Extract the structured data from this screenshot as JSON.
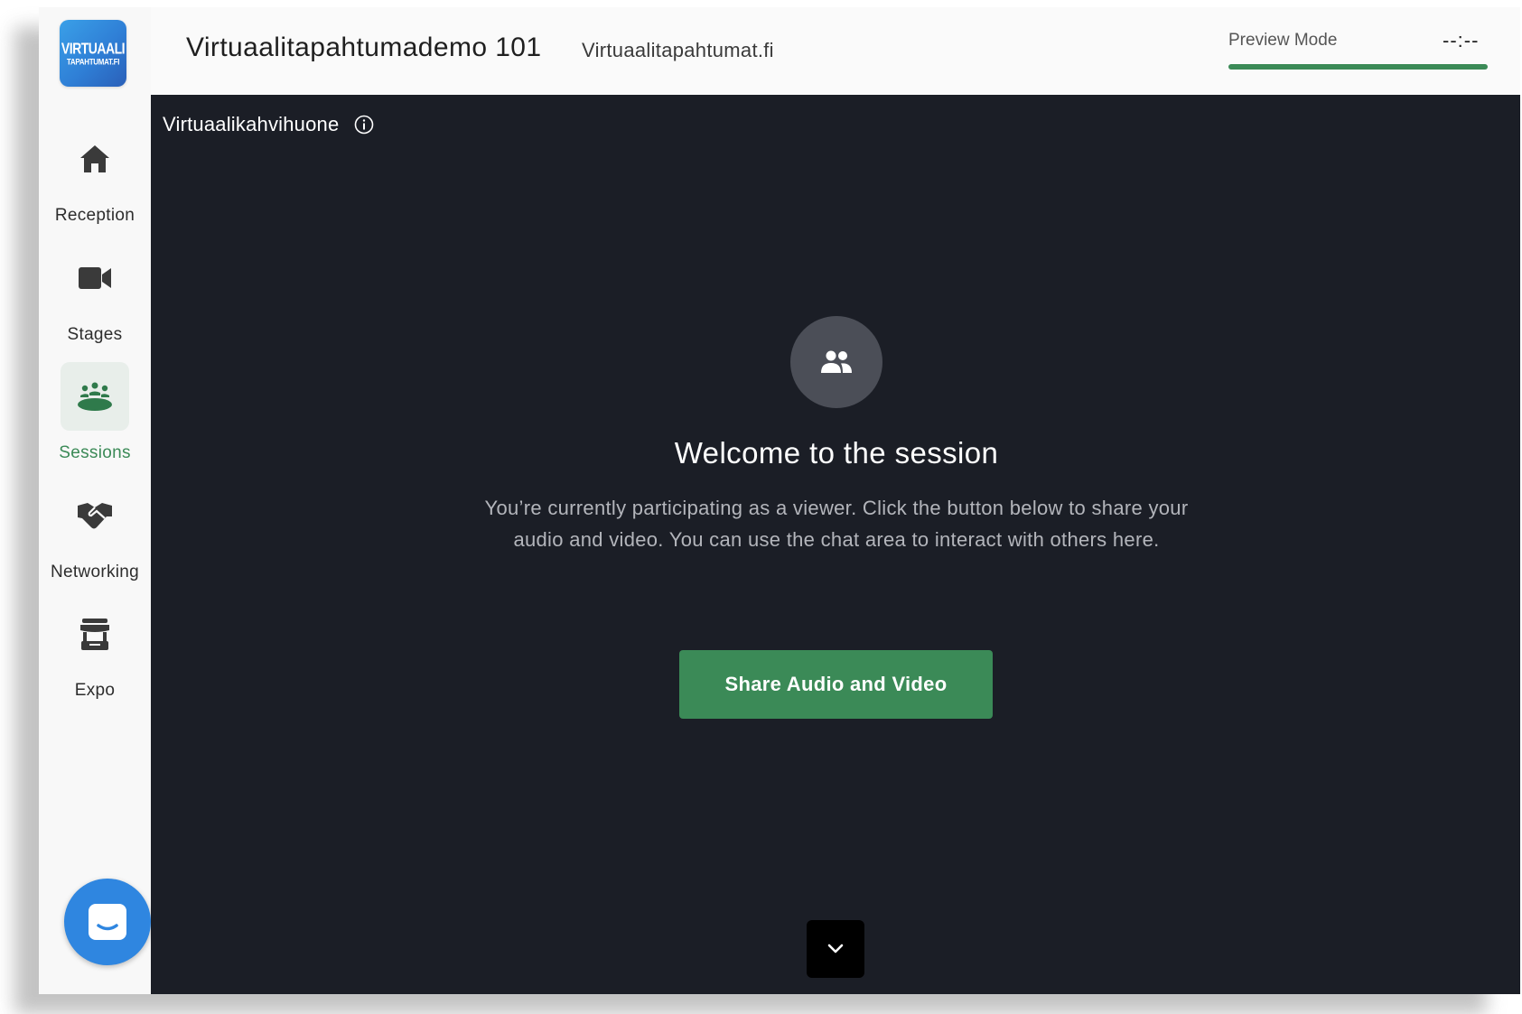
{
  "logo": {
    "line1": "VIRTUAALI",
    "line2": "TAPAHTUMAT.FI"
  },
  "sidebar": {
    "items": [
      {
        "label": "Reception",
        "icon": "home-icon",
        "active": false
      },
      {
        "label": "Stages",
        "icon": "video-camera-icon",
        "active": false
      },
      {
        "label": "Sessions",
        "icon": "group-table-icon",
        "active": true
      },
      {
        "label": "Networking",
        "icon": "handshake-icon",
        "active": false
      },
      {
        "label": "Expo",
        "icon": "booth-icon",
        "active": false
      }
    ]
  },
  "header": {
    "event_title": "Virtuaalitapahtumademo 101",
    "organizer": "Virtuaalitapahtumat.fi",
    "preview_mode": "Preview Mode",
    "timer": "--:--",
    "progress": 1.0
  },
  "main": {
    "room_name": "Virtuaalikahvihuone",
    "welcome_title": "Welcome to the session",
    "description": "You’re currently participating as a viewer. Click the button below to share your audio and video. You can use the chat area to interact with others here.",
    "share_button": "Share Audio and Video"
  },
  "colors": {
    "accent": "#3b8a57",
    "main_bg": "#1b1e26",
    "sidebar_bg": "#f8f8f8",
    "chat_blue": "#2f86e0"
  }
}
